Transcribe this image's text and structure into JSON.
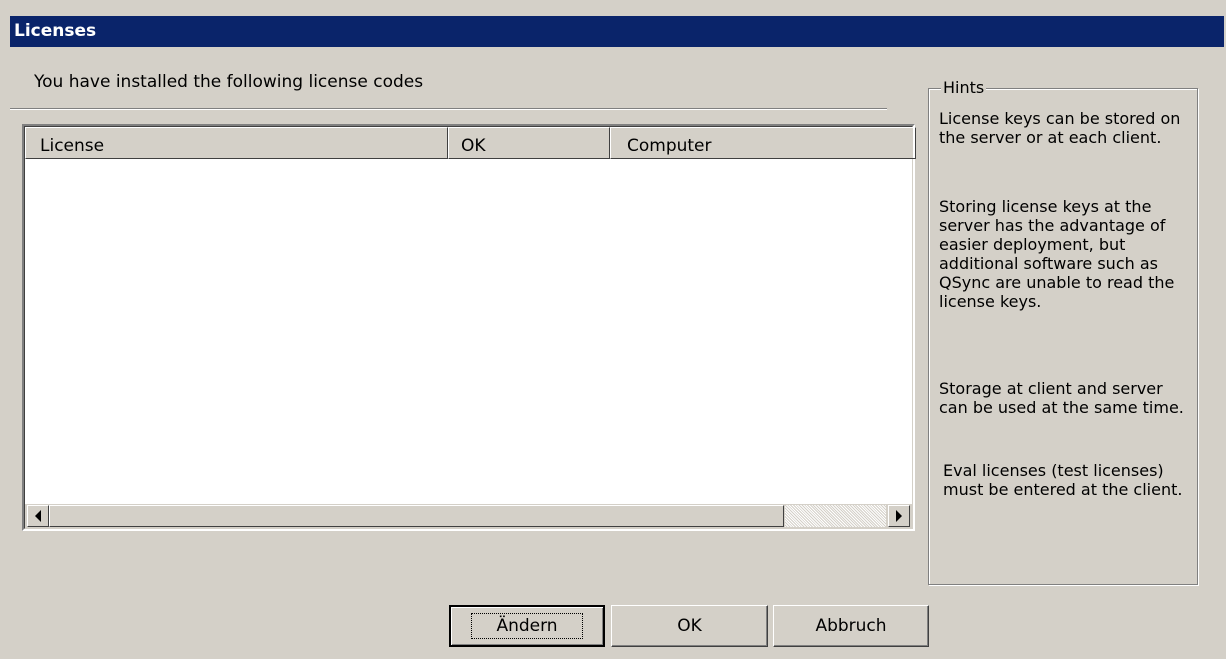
{
  "window": {
    "title": "Licenses"
  },
  "intro_text": "You have installed the following license codes",
  "table": {
    "columns": [
      "License",
      "OK",
      "Computer"
    ],
    "rows": []
  },
  "hints": {
    "legend": "Hints",
    "paragraphs": [
      "License keys can be stored on the server or at each client.",
      "Storing license keys at the server has the advantage of easier deployment, but additional software such as QSync are unable to read the license keys.",
      "Storage at client and server can be used at the same time.",
      "Eval licenses (test licenses) must be entered at the client."
    ]
  },
  "buttons": {
    "change": "Ändern",
    "ok": "OK",
    "cancel": "Abbruch"
  },
  "colors": {
    "titlebar": "#0a246a",
    "window_bg": "#d4d0c8"
  }
}
